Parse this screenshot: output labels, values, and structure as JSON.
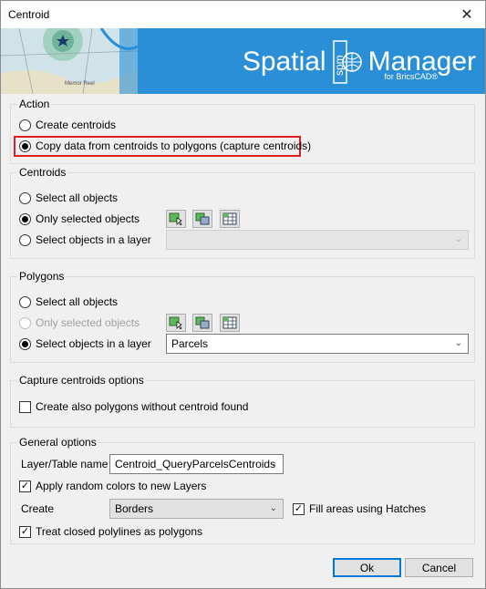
{
  "window": {
    "title": "Centroid",
    "close_glyph": "✕"
  },
  "banner": {
    "brand_left": "Spatial",
    "brand_logo": "spm",
    "brand_right": "Manager",
    "subtitle": "for BricsCAD®",
    "map_text": "Memor Reel"
  },
  "action": {
    "label": "Action",
    "option_create": "Create centroids",
    "option_copy": "Copy data from centroids to polygons (capture centroids)"
  },
  "centroids": {
    "label": "Centroids",
    "select_all": "Select all objects",
    "only_selected": "Only selected objects",
    "select_layer": "Select objects in a layer",
    "layer_value": ""
  },
  "polygons": {
    "label": "Polygons",
    "select_all": "Select all objects",
    "only_selected": "Only selected objects",
    "select_layer": "Select objects in a layer",
    "layer_value": "Parcels"
  },
  "capture": {
    "label": "Capture centroids options",
    "create_also": "Create also polygons without centroid found"
  },
  "general": {
    "label": "General options",
    "layer_table_label": "Layer/Table name",
    "layer_table_value": "Centroid_QueryParcelsCentroids",
    "random_colors": "Apply random colors to new Layers",
    "create_label": "Create",
    "create_value": "Borders",
    "fill_hatches": "Fill areas using Hatches",
    "treat_closed": "Treat closed polylines as polygons"
  },
  "buttons": {
    "ok": "Ok",
    "cancel": "Cancel"
  }
}
